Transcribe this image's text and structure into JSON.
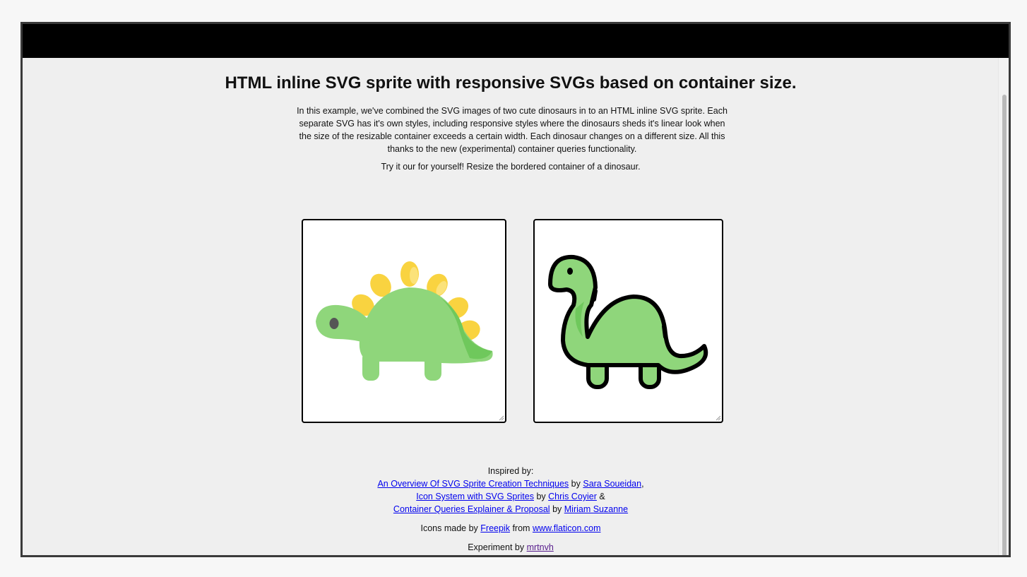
{
  "page": {
    "title": "HTML inline SVG sprite with responsive SVGs based on container size.",
    "intro": "In this example, we've combined the SVG images of two cute dinosaurs in to an HTML inline SVG sprite. Each separate SVG has it's own styles, including responsive styles where the dinosaurs sheds it's linear look when the size of the resizable container exceeds a certain width. Each dinosaur changes on a different size. All this thanks to the new (experimental) container queries functionality.",
    "try_text": "Try it our for yourself! Resize the bordered container of a dinosaur."
  },
  "dinosaurs": [
    {
      "name": "stegosaurus",
      "style": "filled"
    },
    {
      "name": "brontosaurus",
      "style": "outlined"
    }
  ],
  "colors": {
    "dino_green": "#8fd67b",
    "dino_green_dark": "#6fc85c",
    "spike_yellow": "#f9d340",
    "outline": "#000000",
    "link": "#0000ee",
    "visited_link": "#551a8b"
  },
  "credits": {
    "inspired_label": "Inspired by:",
    "line1": {
      "link1": "An Overview Of SVG Sprite Creation Techniques",
      "by": "by",
      "link2": "Sara Soueidan",
      "sep": ","
    },
    "line2": {
      "link1": "Icon System with SVG Sprites",
      "by": "by",
      "link2": "Chris Coyier",
      "sep": "&"
    },
    "line3": {
      "link1": "Container Queries Explainer & Proposal",
      "by": "by",
      "link2": "Miriam Suzanne"
    },
    "icons": {
      "prefix": "Icons made by",
      "author": "Freepik",
      "from": "from",
      "site": "www.flaticon.com"
    },
    "experiment": {
      "prefix": "Experiment by",
      "author": "mrtnvh"
    }
  }
}
